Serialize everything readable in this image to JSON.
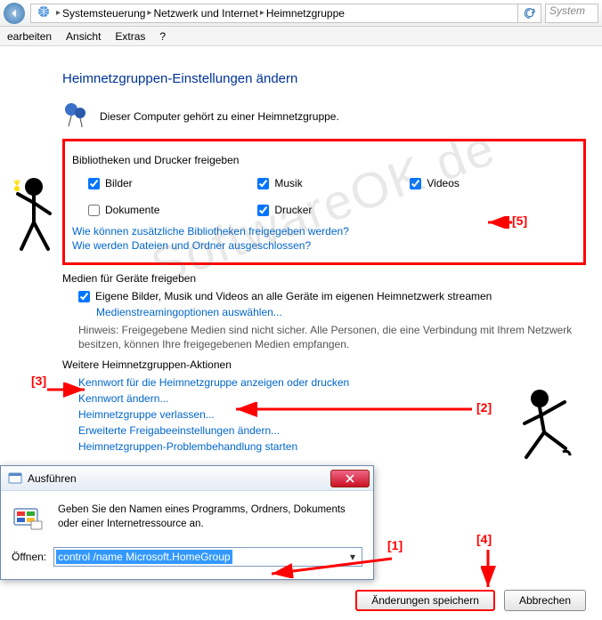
{
  "nav": {
    "crumbs": [
      "Systemsteuerung",
      "Netzwerk und Internet",
      "Heimnetzgruppe"
    ],
    "search_placeholder": "System"
  },
  "menu": {
    "items": [
      "earbeiten",
      "Ansicht",
      "Extras",
      "?"
    ]
  },
  "page": {
    "title": "Heimnetzgruppen-Einstellungen ändern",
    "belongs": "Dieser Computer gehört zu einer Heimnetzgruppe."
  },
  "sharing": {
    "legend": "Bibliotheken und Drucker freigeben",
    "items": [
      {
        "label": "Bilder",
        "checked": true
      },
      {
        "label": "Dokumente",
        "checked": false
      },
      {
        "label": "Musik",
        "checked": true
      },
      {
        "label": "Drucker",
        "checked": true
      },
      {
        "label": "Videos",
        "checked": true
      }
    ],
    "link1": "Wie können zusätzliche Bibliotheken freigegeben werden?",
    "link2": "Wie werden Dateien und Ordner ausgeschlossen?"
  },
  "media": {
    "legend": "Medien für Geräte freigeben",
    "stream_label": "Eigene Bilder, Musik und Videos an alle Geräte im eigenen Heimnetzwerk streamen",
    "stream_link": "Medienstreamingoptionen auswählen...",
    "hint": "Hinweis: Freigegebene Medien sind nicht sicher. Alle Personen, die eine Verbindung mit Ihrem Netzwerk besitzen, können Ihre freigegebenen Medien empfangen."
  },
  "actions": {
    "legend": "Weitere Heimnetzgruppen-Aktionen",
    "items": [
      "Kennwort für die Heimnetzgruppe anzeigen oder drucken",
      "Kennwort ändern...",
      "Heimnetzgruppe verlassen...",
      "Erweiterte Freigabeeinstellungen ändern...",
      "Heimnetzgruppen-Problembehandlung starten"
    ]
  },
  "run": {
    "title": "Ausführen",
    "desc": "Geben Sie den Namen eines Programms, Ordners, Dokuments oder einer Internetressource an.",
    "open_label": "Öffnen:",
    "value": "control /name Microsoft.HomeGroup"
  },
  "buttons": {
    "save": "Änderungen speichern",
    "cancel": "Abbrechen"
  },
  "anno": {
    "n1": "[1]",
    "n2": "[2]",
    "n3": "[3]",
    "n4": "[4]",
    "n5": "[5]"
  },
  "watermark": "SoftwareOK.de"
}
